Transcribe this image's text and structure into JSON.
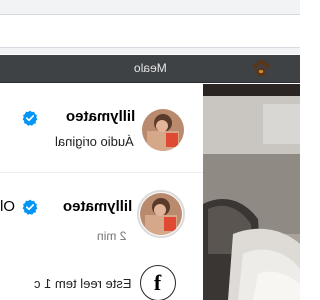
{
  "window": {
    "title": "Mealo"
  },
  "post": {
    "author": "lillymateo",
    "audio": "Áudio original"
  },
  "comments": [
    {
      "author": "lillymateo",
      "text_preview": "Ol",
      "time": "2 min"
    },
    {
      "text_preview": "Este reel tem 1 c"
    }
  ],
  "icons": {
    "verified": "verified-badge-icon",
    "paw": "paw-icon",
    "facebook": "facebook-icon"
  },
  "colors": {
    "verified_blue": "#0095f6",
    "strip": "#3f4245",
    "muted": "#737373"
  }
}
